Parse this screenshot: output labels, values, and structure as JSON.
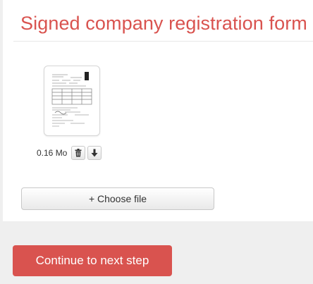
{
  "form": {
    "title": "Signed company registration form"
  },
  "uploaded_file": {
    "size_label": "0.16 Mo",
    "thumbnail": "document-preview",
    "actions": {
      "delete_icon": "trash-icon",
      "download_icon": "download-arrow-icon"
    }
  },
  "upload": {
    "choose_label": "+ Choose file"
  },
  "footer": {
    "continue_label": "Continue to next step"
  },
  "colors": {
    "accent": "#d9534f",
    "background": "#efefef",
    "card": "#ffffff"
  }
}
